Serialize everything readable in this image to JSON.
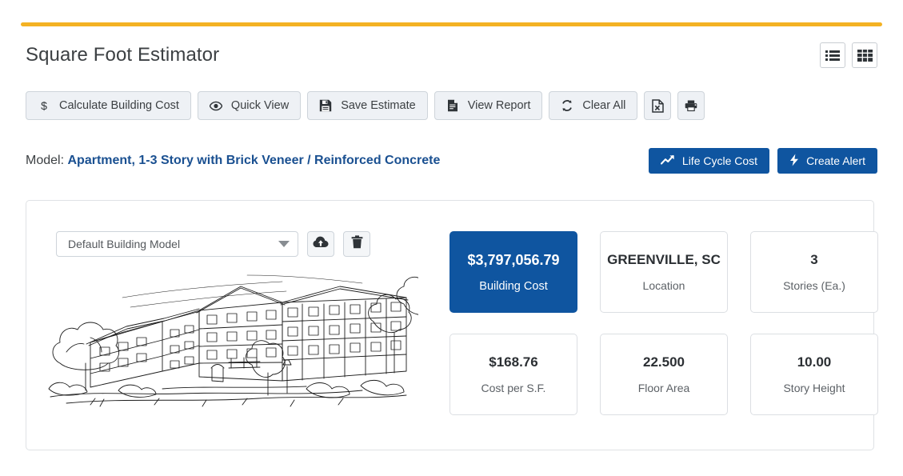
{
  "header": {
    "title": "Square Foot Estimator",
    "view_toggles": [
      {
        "name": "list-view-toggle",
        "icon": "list-icon"
      },
      {
        "name": "grid-view-toggle",
        "icon": "grid-icon"
      }
    ]
  },
  "toolbar": {
    "buttons": [
      {
        "label": "Calculate Building Cost",
        "icon": "dollar-icon"
      },
      {
        "label": "Quick View",
        "icon": "eye-icon"
      },
      {
        "label": "Save Estimate",
        "icon": "floppy-disk-icon"
      },
      {
        "label": "View Report",
        "icon": "document-icon"
      },
      {
        "label": "Clear All",
        "icon": "refresh-icon"
      }
    ],
    "icon_buttons": [
      {
        "label": "",
        "icon": "excel-export-icon"
      },
      {
        "label": "",
        "icon": "print-icon"
      }
    ]
  },
  "model": {
    "prefix": "Model:",
    "name": "Apartment, 1-3 Story with Brick Veneer / Reinforced Concrete",
    "actions": [
      {
        "label": "Life Cycle Cost",
        "icon": "trend-chart-icon"
      },
      {
        "label": "Create Alert",
        "icon": "lightning-bolt-icon"
      }
    ]
  },
  "panel": {
    "model_select": {
      "value": "Default Building Model",
      "placeholder": "Default Building Model"
    },
    "select_actions": [
      {
        "name": "upload-model-button",
        "icon": "cloud-upload-icon"
      },
      {
        "name": "delete-model-button",
        "icon": "trash-icon"
      }
    ],
    "illustration": "apartment-building-sketch",
    "cards": [
      {
        "value": "$3,797,056.79",
        "label": "Building Cost",
        "primary": true
      },
      {
        "value": "GREENVILLE, SC",
        "label": "Location",
        "primary": false
      },
      {
        "value": "3",
        "label": "Stories (Ea.)",
        "primary": false
      },
      {
        "value": "$168.76",
        "label": "Cost per S.F.",
        "primary": false
      },
      {
        "value": "22.500",
        "label": "Floor Area",
        "primary": false
      },
      {
        "value": "10.00",
        "label": "Story Height",
        "primary": false
      }
    ]
  },
  "colors": {
    "accent_bar": "#f4b223",
    "primary_blue": "#0f55a0",
    "link_blue": "#1a5091",
    "toolbar_bg": "#eef1f5"
  }
}
